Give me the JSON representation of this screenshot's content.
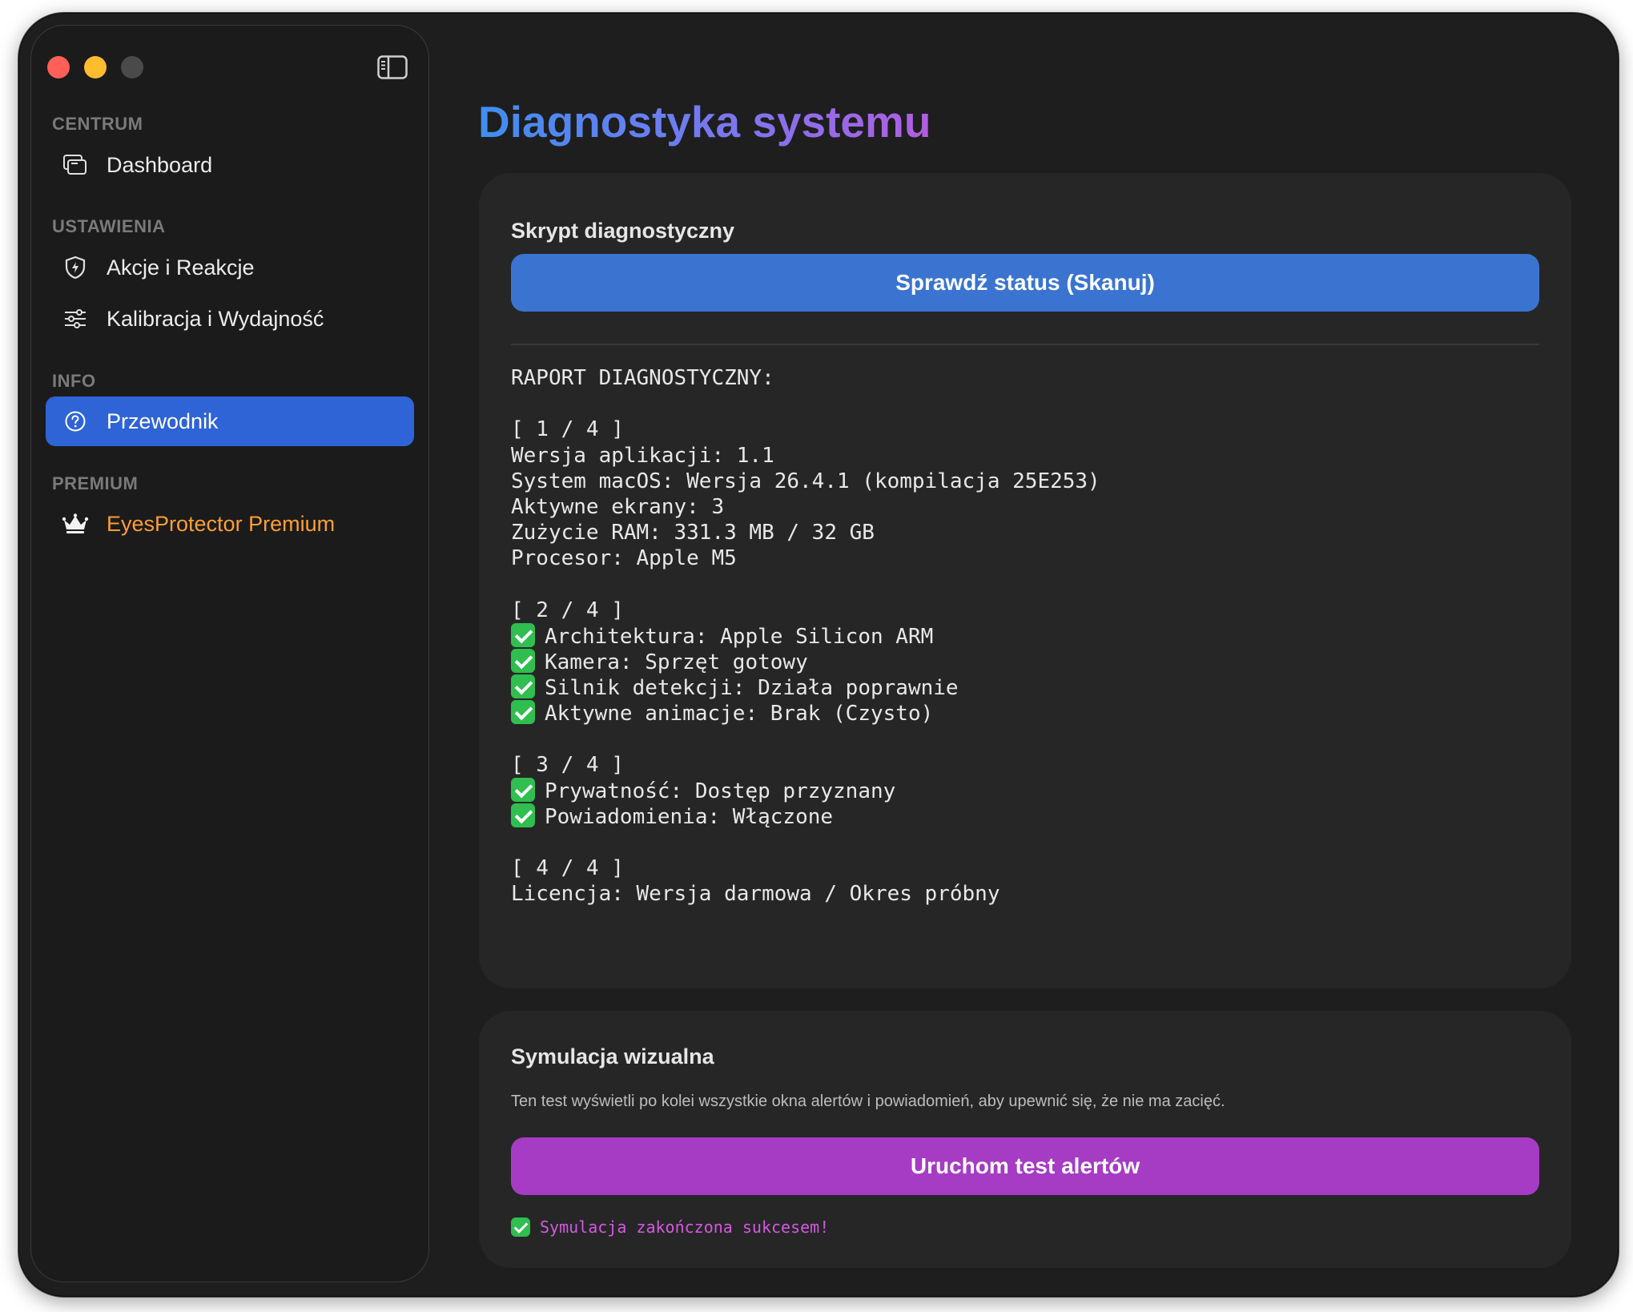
{
  "sidebar": {
    "sections": {
      "centrum": "CENTRUM",
      "ustawienia": "USTAWIENIA",
      "info": "INFO",
      "premium": "PREMIUM"
    },
    "items": {
      "dashboard": "Dashboard",
      "actions": "Akcje i Reakcje",
      "calibration": "Kalibracja i Wydajność",
      "guide": "Przewodnik",
      "premium": "EyesProtector Premium"
    }
  },
  "main": {
    "title": "Diagnostyka systemu",
    "diagnostic_card": {
      "title": "Skrypt diagnostyczny",
      "button": "Sprawdź status (Skanuj)",
      "report": [
        {
          "text": "RAPORT DIAGNOSTYCZNY:",
          "check": false
        },
        {
          "text": "",
          "check": false
        },
        {
          "text": "[ 1 / 4 ]",
          "check": false
        },
        {
          "text": "Wersja aplikacji: 1.1",
          "check": false
        },
        {
          "text": "System macOS: Wersja 26.4.1 (kompilacja 25E253)",
          "check": false
        },
        {
          "text": "Aktywne ekrany: 3",
          "check": false
        },
        {
          "text": "Zużycie RAM: 331.3 MB / 32 GB",
          "check": false
        },
        {
          "text": "Procesor: Apple M5",
          "check": false
        },
        {
          "text": "",
          "check": false
        },
        {
          "text": "[ 2 / 4 ]",
          "check": false
        },
        {
          "text": "Architektura: Apple Silicon ARM",
          "check": true
        },
        {
          "text": "Kamera: Sprzęt gotowy",
          "check": true
        },
        {
          "text": "Silnik detekcji: Działa poprawnie",
          "check": true
        },
        {
          "text": "Aktywne animacje: Brak (Czysto)",
          "check": true
        },
        {
          "text": "",
          "check": false
        },
        {
          "text": "[ 3 / 4 ]",
          "check": false
        },
        {
          "text": "Prywatność: Dostęp przyznany",
          "check": true
        },
        {
          "text": "Powiadomienia: Włączone",
          "check": true
        },
        {
          "text": "",
          "check": false
        },
        {
          "text": "[ 4 / 4 ]",
          "check": false
        },
        {
          "text": "Licencja: Wersja darmowa / Okres próbny",
          "check": false
        }
      ]
    },
    "simulation_card": {
      "title": "Symulacja wizualna",
      "description": "Ten test wyświetli po kolei wszystkie okna alertów i powiadomień, aby upewnić się, że nie ma zacięć.",
      "button": "Uruchom test alertów",
      "result": "Symulacja zakończona sukcesem!"
    }
  },
  "colors": {
    "accent_blue": "#2f64d6",
    "button_blue": "#3a74d0",
    "button_purple": "#a63cc4",
    "premium_orange": "#ff9e33",
    "check_green": "#2fbe4f",
    "success_text": "#d35ae0"
  }
}
